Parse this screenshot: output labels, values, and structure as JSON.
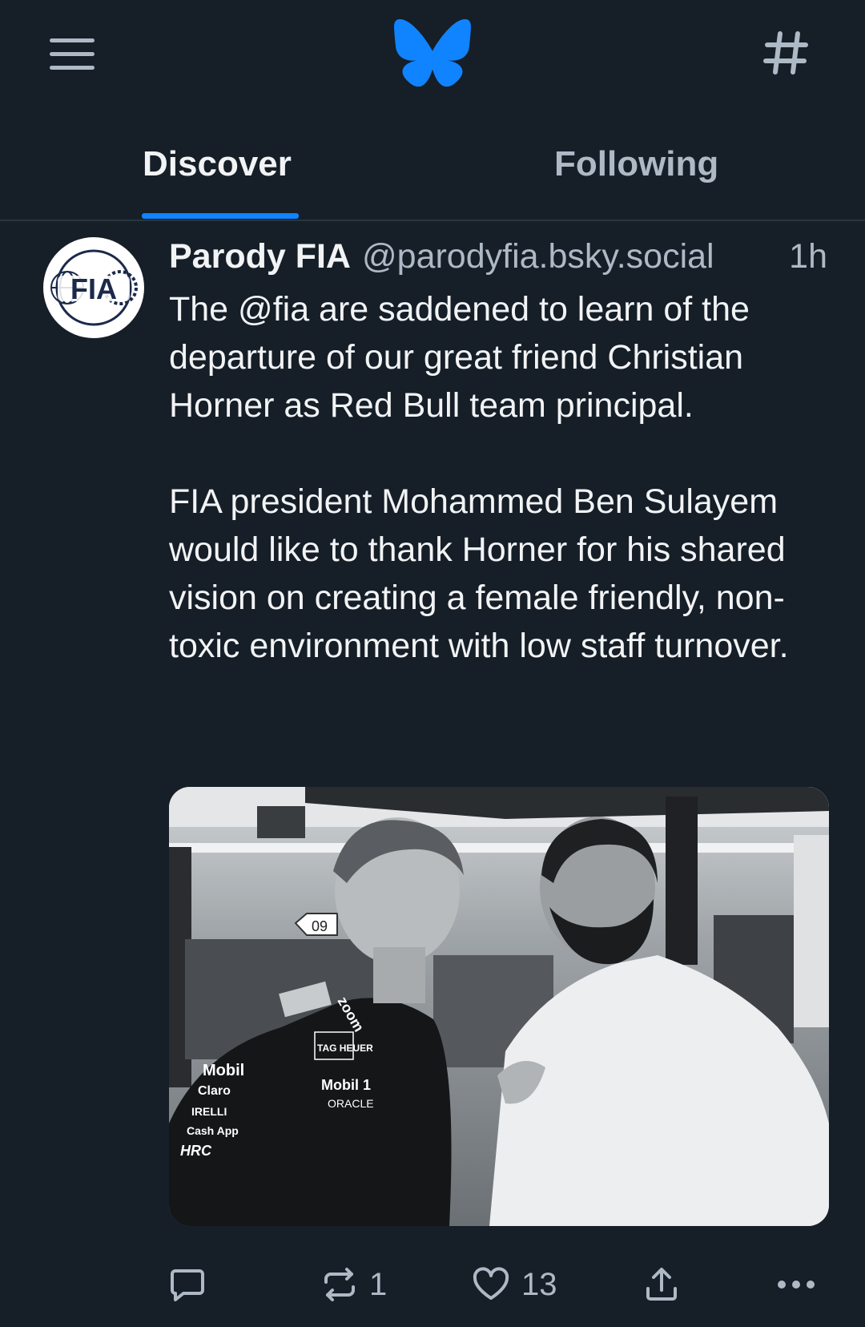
{
  "colors": {
    "background": "#161e27",
    "accent": "#1083fe",
    "muted": "#aeb9c6",
    "text": "#f1f3f5"
  },
  "header": {
    "menu_icon": "hamburger-menu-icon",
    "logo": "bluesky-butterfly-logo",
    "feeds_icon": "hashtag-icon"
  },
  "tabs": [
    {
      "label": "Discover",
      "active": true
    },
    {
      "label": "Following",
      "active": false
    }
  ],
  "post": {
    "avatar_text": "FIA",
    "author_name": "Parody FIA",
    "author_handle": "@parodyfia.bsky.social",
    "time": "1h",
    "text": "The @fia are saddened to learn of the departure of our great friend Christian Horner as Red Bull team principal.\n\nFIA president Mohammed Ben Sulayem would like to thank Horner for his shared vision on creating a female friendly, non-toxic environment with low staff turnover.",
    "image": {
      "garage_number": "09",
      "shirt_logos_left": [
        "Mobil",
        "Claro",
        "IRELLI",
        "Cash App",
        "HRC"
      ],
      "shirt_logos_right": [
        "zoom",
        "TAG HEUER",
        "Mobil 1",
        "ORACLE"
      ]
    },
    "actions": {
      "reply_icon": "reply-bubble-icon",
      "repost_icon": "repost-icon",
      "repost_count": "1",
      "like_icon": "heart-icon",
      "like_count": "13",
      "share_icon": "share-icon",
      "more_icon": "more-dots-icon"
    }
  }
}
